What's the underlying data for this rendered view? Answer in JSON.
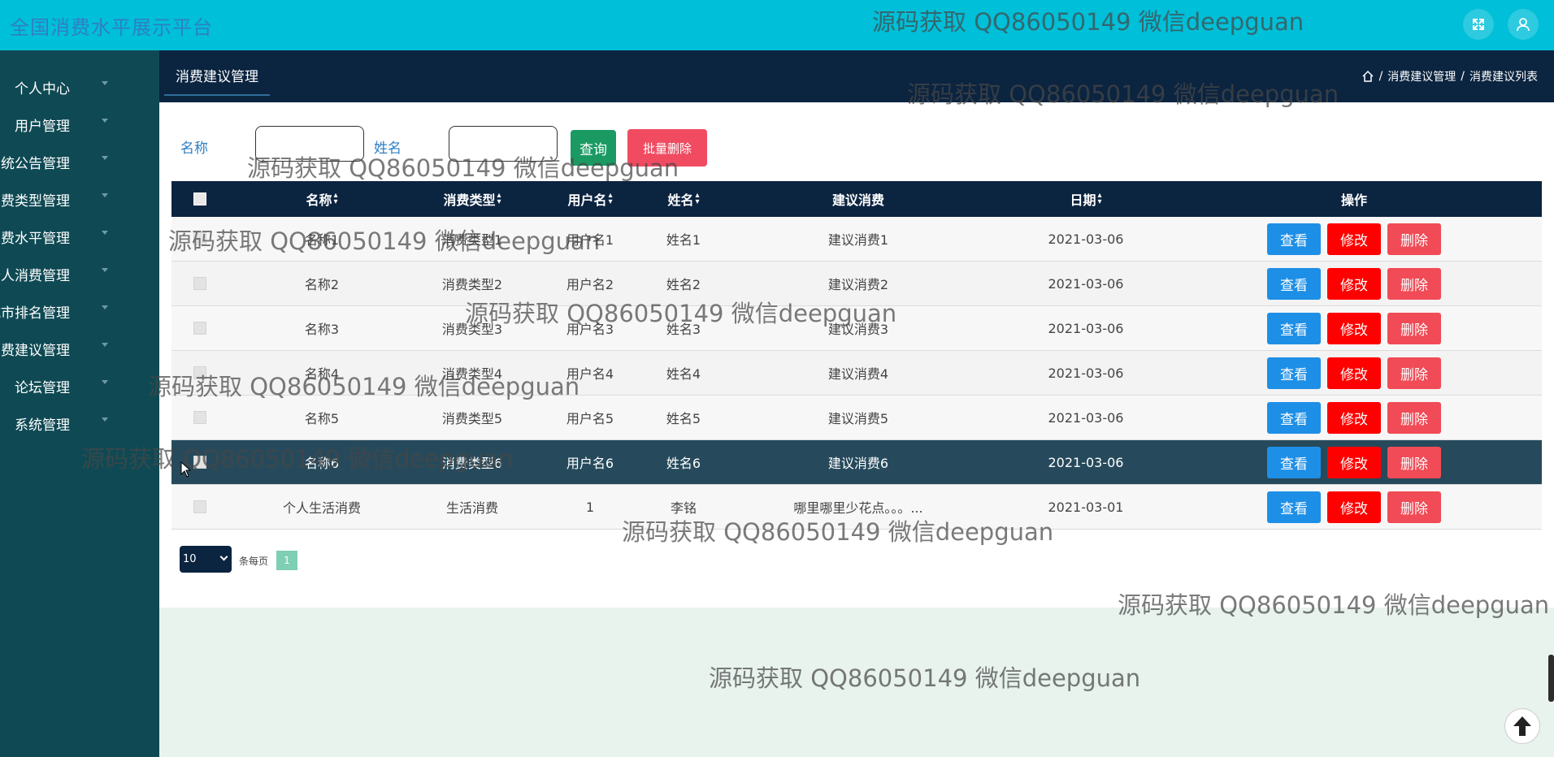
{
  "app": {
    "title": "全国消费水平展示平台"
  },
  "header_icons": [
    {
      "name": "fullscreen-icon"
    },
    {
      "name": "user-icon"
    }
  ],
  "sidebar": {
    "items": [
      {
        "label": "个人中心"
      },
      {
        "label": "用户管理"
      },
      {
        "label": "系统公告管理"
      },
      {
        "label": "消费类型管理"
      },
      {
        "label": "消费水平管理"
      },
      {
        "label": "个人消费管理"
      },
      {
        "label": "城市排名管理"
      },
      {
        "label": "消费建议管理"
      },
      {
        "label": "论坛管理"
      },
      {
        "label": "系统管理"
      }
    ]
  },
  "page": {
    "tab": "消费建议管理",
    "breadcrumb": [
      "消费建议管理",
      "消费建议列表"
    ]
  },
  "search": {
    "name_label": "名称",
    "name_value": "",
    "person_label": "姓名",
    "person_value": "",
    "query_label": "查询",
    "batch_delete_label": "批量删除"
  },
  "table": {
    "columns": [
      "名称",
      "消费类型",
      "用户名",
      "姓名",
      "建议消费",
      "日期",
      "操作"
    ],
    "rows": [
      {
        "name": "名称1",
        "type": "消费类型1",
        "username": "用户名1",
        "person": "姓名1",
        "suggest": "建议消费1",
        "date": "2021-03-06"
      },
      {
        "name": "名称2",
        "type": "消费类型2",
        "username": "用户名2",
        "person": "姓名2",
        "suggest": "建议消费2",
        "date": "2021-03-06"
      },
      {
        "name": "名称3",
        "type": "消费类型3",
        "username": "用户名3",
        "person": "姓名3",
        "suggest": "建议消费3",
        "date": "2021-03-06"
      },
      {
        "name": "名称4",
        "type": "消费类型4",
        "username": "用户名4",
        "person": "姓名4",
        "suggest": "建议消费4",
        "date": "2021-03-06"
      },
      {
        "name": "名称5",
        "type": "消费类型5",
        "username": "用户名5",
        "person": "姓名5",
        "suggest": "建议消费5",
        "date": "2021-03-06"
      },
      {
        "name": "名称6",
        "type": "消费类型6",
        "username": "用户名6",
        "person": "姓名6",
        "suggest": "建议消费6",
        "date": "2021-03-06"
      },
      {
        "name": "个人生活消费",
        "type": "生活消费",
        "username": "1",
        "person": "李铭",
        "suggest": "哪里哪里少花点。。。...",
        "date": "2021-03-01"
      }
    ],
    "actions": {
      "view": "查看",
      "edit": "修改",
      "delete": "删除"
    }
  },
  "pagination": {
    "page_size": "10",
    "per_page_label": "条每页",
    "current_page": "1"
  },
  "watermark": {
    "text": "源码获取 QQ86050149 微信deepguan"
  },
  "colors": {
    "topbar": "#00bfd8",
    "sidebar": "#0f4a54",
    "header": "#0b2440",
    "view": "#1e8fe6",
    "edit": "#ff0000",
    "delete": "#f04b56",
    "query": "#1a9a62"
  }
}
